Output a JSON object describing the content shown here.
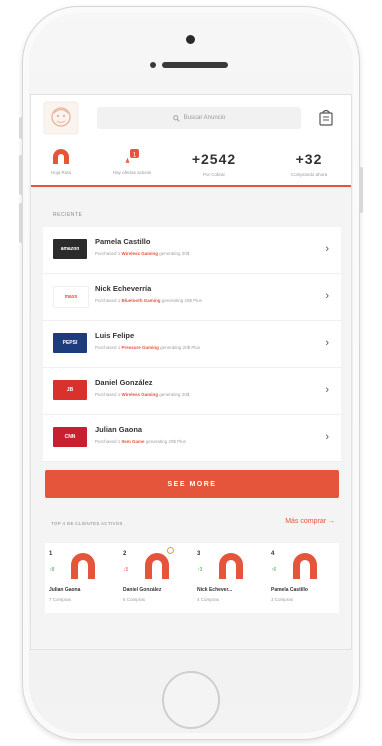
{
  "search": {
    "placeholder": "Buscar Anuncio"
  },
  "stats": [
    {
      "label": "Hoja Ruta",
      "value": ""
    },
    {
      "label": "Hay ofertas activas",
      "value": ""
    },
    {
      "label": "Por Cobrar",
      "value": "+2542"
    },
    {
      "label": "Comprando ahora",
      "value": "+32"
    }
  ],
  "recent": {
    "label": "RECIENTE",
    "items": [
      {
        "logo": "amazon",
        "logo_color": "#2b2b2b",
        "name": "Pamela Castillo",
        "sub_prefix": "Purchased 1",
        "sub_item": "Wireless Gaming",
        "sub_suffix": "generating 20$"
      },
      {
        "logo": "maxx",
        "logo_color": "#ffffff",
        "name": "Nick Echeverría",
        "sub_prefix": "Purchased 1",
        "sub_item": "Bluetooth Gaming",
        "sub_suffix": "generating 20$ Plus"
      },
      {
        "logo": "PEPSI",
        "logo_color": "#1d3c7c",
        "name": "Luis Felipe",
        "sub_prefix": "Purchased 1",
        "sub_item": "Pressure Gaming",
        "sub_suffix": "generating 20$ Plus"
      },
      {
        "logo": "JB",
        "logo_color": "#d9312b",
        "name": "Daniel González",
        "sub_prefix": "Purchased 1",
        "sub_item": "Wireless Gaming",
        "sub_suffix": "generating 20$"
      },
      {
        "logo": "CNN",
        "logo_color": "#c8202f",
        "name": "Julian Gaona",
        "sub_prefix": "Purchased 1",
        "sub_item": "Item Game",
        "sub_suffix": "generating 20$ Plus"
      }
    ]
  },
  "see_more": "SEE MORE",
  "top_customers": {
    "label": "TOP 4 DE CLIENTES ACTIVOS",
    "more_link": "Más comprar →",
    "items": [
      {
        "rank": "1",
        "trend": "↑8",
        "trend_dir": "up",
        "name": "Julian Gaona",
        "count": "7 Compras"
      },
      {
        "rank": "2",
        "trend": "↓5",
        "trend_dir": "down",
        "name": "Daniel González",
        "count": "6 Compras"
      },
      {
        "rank": "3",
        "trend": "↑3",
        "trend_dir": "up",
        "name": "Nick Echever...",
        "count": "4 Compras"
      },
      {
        "rank": "4",
        "trend": "↑6",
        "trend_dir": "up",
        "name": "Pamela Castillo",
        "count": "3 Compras"
      }
    ]
  },
  "colors": {
    "accent": "#e4553c",
    "text": "#333333",
    "muted": "#9a9a9a"
  }
}
